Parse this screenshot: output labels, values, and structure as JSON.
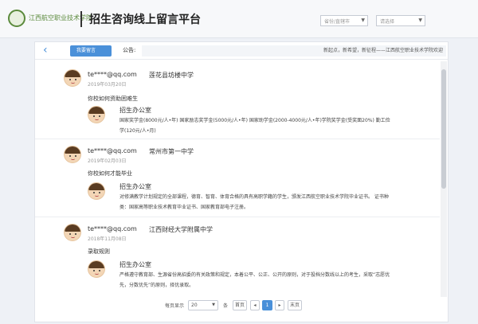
{
  "header": {
    "logo_text": "江西航空职业技术学院",
    "title": "招生咨询线上留言平台",
    "select1_placeholder": "省份/直辖市",
    "select2_placeholder": "请选择"
  },
  "toolbar": {
    "message_button": "我要留言",
    "notice_label": "公告:",
    "notice_text": "新起点，新希望，新征程——江西航空职业技术学院欢迎"
  },
  "entries": [
    {
      "user": "te****@qq.com",
      "school": "莲花县坊楼中学",
      "date": "2019年03月20日",
      "question": "你校如何资助困难生",
      "replier": "招生办公室",
      "reply": "国家奖学金(8000元/人•年)  国家励志奖学金(5000元/人•年)  国家助学金(2000-4000元/人•年)学院奖学金(受奖面20%)    勤工俭学(120元/人•月)"
    },
    {
      "user": "te****@qq.com",
      "school": "常州市第一中学",
      "date": "2019年02月03日",
      "question": "你校如何才能毕业",
      "replier": "招生办公室",
      "reply": "对修满教学计划规定的全部课程，德育、智育、体育合格的具有高职学籍的学生，颁发江西航空职业技术学院毕业证书。    证书种类：国家高等职业技术教育毕业证书、国家教育部电子注册。"
    },
    {
      "user": "te****@qq.com",
      "school": "江西财经大学附属中学",
      "date": "2018年11月08日",
      "question": "录取规则",
      "replier": "招生办公室",
      "reply": "严格遵守教育部、生源省份高招委的有关政策和规定，本着公平、公正、公开的原则，对于投档分数线以上的考生，采取“志愿优先，分数优先”的原则，择优录取。"
    }
  ],
  "pager": {
    "per_page_label": "每页显示",
    "per_page_value": "20",
    "unit_label": "条",
    "first": "首页",
    "prev": "◂",
    "current": "1",
    "next": "▸",
    "last": "末页"
  },
  "colors": {
    "accent": "#4a90d9",
    "logo_green": "#5b8a3c"
  }
}
